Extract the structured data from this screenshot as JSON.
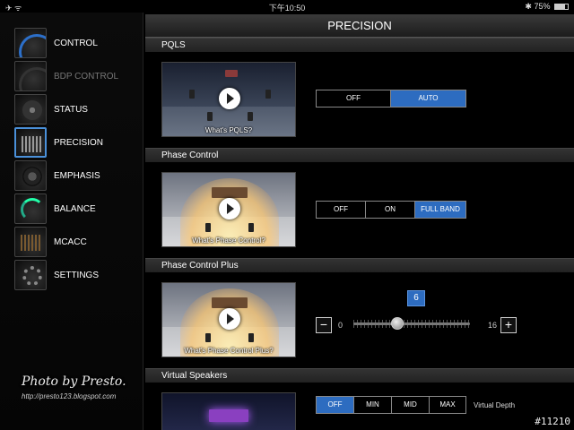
{
  "status": {
    "time": "下午10:50",
    "battery": "75%"
  },
  "sidebar": {
    "items": [
      {
        "label": "CONTROL"
      },
      {
        "label": "BDP CONTROL"
      },
      {
        "label": "STATUS"
      },
      {
        "label": "PRECISION"
      },
      {
        "label": "EMPHASIS"
      },
      {
        "label": "BALANCE"
      },
      {
        "label": "MCACC"
      },
      {
        "label": "SETTINGS"
      }
    ],
    "watermark": "Photo by Presto.",
    "watermark_url": "http://presto123.blogspot.com"
  },
  "main": {
    "title": "PRECISION",
    "pqls": {
      "heading": "PQLS",
      "caption": "What's PQLS?",
      "options": [
        "OFF",
        "AUTO"
      ],
      "selected": "AUTO"
    },
    "phase_control": {
      "heading": "Phase Control",
      "caption": "What's Phase Control?",
      "options": [
        "OFF",
        "ON",
        "FULL BAND"
      ],
      "selected": "FULL BAND"
    },
    "phase_control_plus": {
      "heading": "Phase Control Plus",
      "caption": "What's Phase Control Plus?",
      "value": "6",
      "min": "0",
      "max": "16",
      "minus": "−",
      "plus": "+",
      "level": 6
    },
    "virtual_speakers": {
      "heading": "Virtual Speakers",
      "options": [
        "OFF",
        "MIN",
        "MID",
        "MAX"
      ],
      "selected": "OFF",
      "depth_label": "Virtual Depth"
    }
  },
  "corner_id": "#11210",
  "colors": {
    "accent": "#2d6cc0",
    "background": "#000000"
  }
}
